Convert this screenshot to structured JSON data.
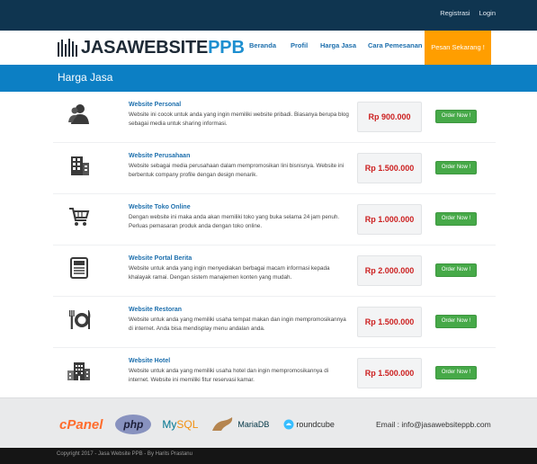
{
  "topbar": {
    "register": "Registrasi",
    "login": "Login"
  },
  "logo": {
    "part1": "JASAWEBSITE",
    "part2": "PPB"
  },
  "nav": {
    "items": [
      "Beranda",
      "Profil",
      "Harga Jasa",
      "Cara Pemesanan"
    ],
    "cta": "Pesan Sekarang !"
  },
  "banner": {
    "title": "Harga Jasa"
  },
  "services": [
    {
      "icon": "user-icon",
      "title": "Website Personal",
      "desc": "Website ini cocok untuk anda yang ingin memiliki website pribadi. Biasanya berupa blog sebagai media untuk sharing informasi.",
      "price": "Rp 900.000",
      "button": "Order Now !"
    },
    {
      "icon": "building-icon",
      "title": "Website Perusahaan",
      "desc": "Website sebagai media perusahaan dalam mempromosikan lini bisnisnya. Website ini berbentuk company profile dengan design menarik.",
      "price": "Rp 1.500.000",
      "button": "Order Now !"
    },
    {
      "icon": "cart-icon",
      "title": "Website Toko Online",
      "desc": "Dengan website ini maka anda akan memiliki toko yang buka selama 24 jam penuh. Perluas pemasaran produk anda dengan toko online.",
      "price": "Rp 1.000.000",
      "button": "Order Now !"
    },
    {
      "icon": "newspaper-icon",
      "title": "Website Portal Berita",
      "desc": "Website untuk anda yang ingin menyediakan berbagai macam informasi kepada khalayak ramai. Dengan sistem manajemen konten yang mudah.",
      "price": "Rp 2.000.000",
      "button": "Order Now !"
    },
    {
      "icon": "restaurant-icon",
      "title": "Website Restoran",
      "desc": "Website untuk anda yang memiliki usaha tempat makan dan ingin mempromosikannya di internet. Anda bisa mendisplay menu andalan anda.",
      "price": "Rp 1.500.000",
      "button": "Order Now !"
    },
    {
      "icon": "hotel-icon",
      "title": "Website Hotel",
      "desc": "Website untuk anda yang memiliki usaha hotel dan ingin mempromosikannya di internet. Website ini memiliki fitur reservasi kamar.",
      "price": "Rp 1.500.000",
      "button": "Order Now !"
    }
  ],
  "footer": {
    "logos": {
      "cpanel": "cPanel",
      "php": "php",
      "mysql_a": "My",
      "mysql_b": "SQL",
      "mariadb": "MariaDB",
      "roundcube": "roundcube"
    },
    "email": "Email : info@jasawebsiteppb.com",
    "copyright": "Copyright 2017 - Jasa Website PPB - By Harits Prastanu"
  },
  "colors": {
    "topbar": "#0f3550",
    "banner": "#0c7fc4",
    "cta": "#ff9e00",
    "order": "#46a948",
    "price": "#cc1f1f",
    "link": "#1d6fad"
  }
}
